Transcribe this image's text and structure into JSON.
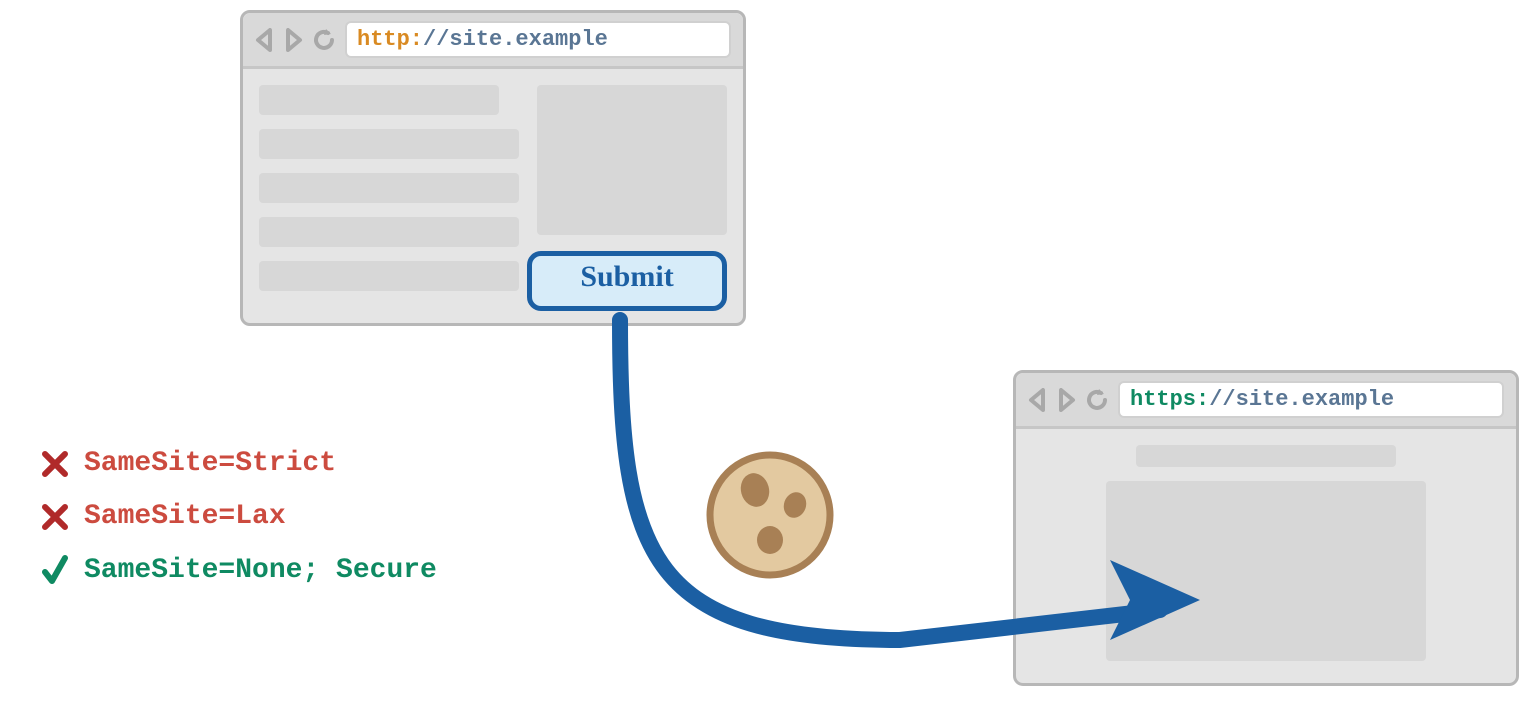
{
  "browser1": {
    "url_scheme": "http:",
    "url_scheme_color": "#d98a22",
    "url_rest": "//site.example",
    "url_rest_color": "#5a7694",
    "submit_label": "Submit"
  },
  "browser2": {
    "url_scheme": "https:",
    "url_scheme_color": "#0f8a62",
    "url_rest": "//site.example",
    "url_rest_color": "#5a7694"
  },
  "legend": {
    "items": [
      {
        "ok": false,
        "text": "SameSite=Strict"
      },
      {
        "ok": false,
        "text": "SameSite=Lax"
      },
      {
        "ok": true,
        "text": "SameSite=None; Secure"
      }
    ],
    "x_color": "#b02a2a",
    "check_color": "#0f8a62",
    "blocked_text_color": "#cc4b3f",
    "allowed_text_color": "#0f8a62"
  },
  "colors": {
    "arrow": "#1b5fa3"
  }
}
